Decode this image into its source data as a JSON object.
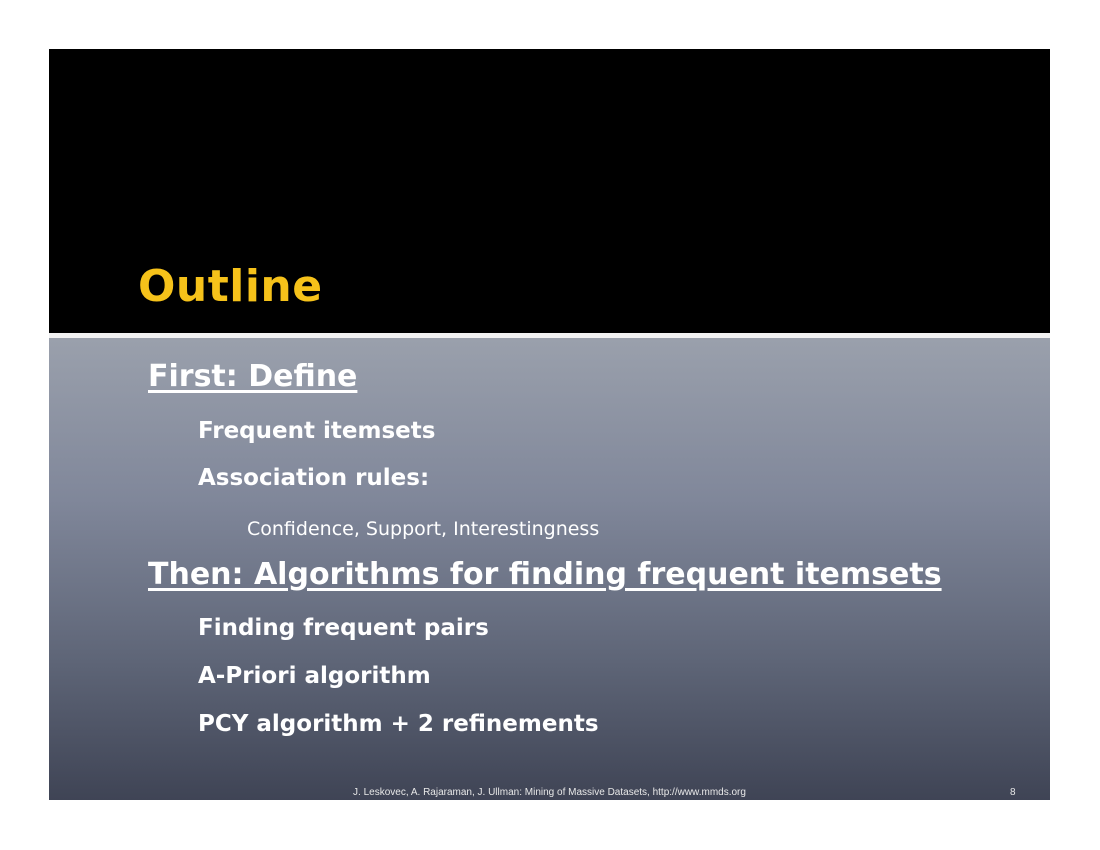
{
  "slide": {
    "title": "Outline",
    "sections": [
      {
        "heading": "First: Define",
        "items": [
          "Frequent itemsets",
          "Association rules:"
        ],
        "subitems": [
          "Confidence, Support, Interestingness"
        ]
      },
      {
        "heading": "Then: Algorithms for finding frequent itemsets",
        "items": [
          "Finding frequent pairs",
          "A-Priori algorithm",
          "PCY algorithm + 2 refinements"
        ]
      }
    ],
    "footer": "J. Leskovec, A. Rajaraman, J. Ullman: Mining of Massive Datasets, http://www.mmds.org",
    "page_number": "8"
  },
  "colors": {
    "title": "#f6c21a",
    "title_band": "#000000",
    "text": "#ffffff"
  }
}
